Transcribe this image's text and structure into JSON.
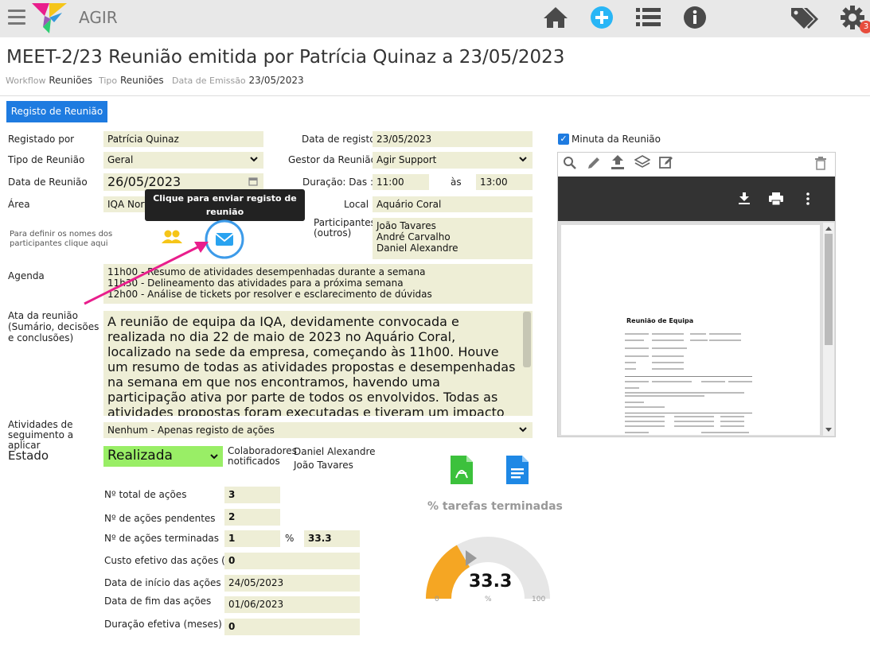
{
  "app": {
    "name": "AGIR",
    "notification_count": "3"
  },
  "icons": [
    "menu-icon",
    "home-icon",
    "add-circle-icon",
    "list-icon",
    "info-icon",
    "tags-icon",
    "gear-icon"
  ],
  "page": {
    "title": "MEET-2/23 Reunião emitida por Patrícia Quinaz a 23/05/2023"
  },
  "meta": {
    "workflow_label": "Workflow",
    "workflow_value": "Reuniões",
    "tipo_label": "Tipo",
    "tipo_value": "Reuniões",
    "data_label": "Data de Emissão",
    "data_value": "23/05/2023"
  },
  "tabs": {
    "registo": "Registo de Reunião"
  },
  "form": {
    "registado_por_label": "Registado por",
    "registado_por": "Patrícia Quinaz",
    "data_registo_label": "Data de registo",
    "data_registo": "23/05/2023",
    "tipo_label": "Tipo de Reunião",
    "tipo": "Geral",
    "gestor_label": "Gestor da Reunião",
    "gestor": "Agir Support",
    "data_reuniao_label": "Data de Reunião",
    "data_reuniao": "26/05/2023",
    "duracao_label": "Duração: Das :",
    "duracao_das": "11:00",
    "as_label": "às",
    "duracao_ate": "13:00",
    "area_label": "Área",
    "area": "IQA Norte",
    "local_label": "Local",
    "local": "Aquário Coral",
    "participantes_hint": "Para definir os nomes dos participantes clique aqui",
    "participantes_outros_label": "Participantes (outros)",
    "participantes_outros": "João Tavares\nAndré Carvalho\nDaniel Alexandre",
    "tooltip": "Clique para enviar registo de reunião",
    "agenda_label": "Agenda",
    "agenda": "11h00 - Resumo de atividades desempenhadas durante a semana\n11h30 - Delineamento das atividades para a próxima semana\n12h00 - Análise de tickets por resolver e esclarecimento de dúvidas",
    "ata_label": "Ata da reunião (Sumário, decisões e conclusões)",
    "ata": "A reunião de equipa da IQA, devidamente convocada e realizada no dia 22 de maio de 2023 no Aquário Coral, localizado na sede da empresa, começando às 11h00.\nHouve um resumo de todas as atividades propostas e desempenhadas na semana em que nos encontramos, havendo uma participação ativa por parte de todos os envolvidos. Todas as atividades propostas foram executadas e tiveram um impacto positivo na atividade da empresa.",
    "atividades_label": "Atividades de seguimento a aplicar",
    "atividades": "Nenhum - Apenas registo de ações",
    "estado_label": "Estado",
    "estado": "Realizada",
    "colab_label": "Colaboradores notificados",
    "colab_1": "Daniel Alexandre",
    "colab_2": "João Tavares"
  },
  "stats": {
    "total_label": "Nº total de ações",
    "total": "3",
    "pendentes_label": "Nº de ações pendentes",
    "pendentes": "2",
    "terminadas_label": "Nº de ações terminadas",
    "terminadas": "1",
    "pct_label": "%",
    "pct": "33.3",
    "custo_label": "Custo efetivo das ações (€)",
    "custo": "0",
    "inicio_label": "Data de início das ações",
    "inicio": "24/05/2023",
    "fim_label": "Data de fim das ações",
    "fim": "01/06/2023",
    "duracao_label": "Duração efetiva (meses)",
    "duracao": "0"
  },
  "gauge": {
    "title": "% tarefas terminadas",
    "value": 33.3,
    "value_text": "33.3",
    "min": "0",
    "unit": "%",
    "max": "100",
    "color": "#f5a623"
  },
  "viewer": {
    "checkbox_label": "Minuta da Reunião",
    "checked": true,
    "doc_title": "Reunião de Equipa"
  }
}
